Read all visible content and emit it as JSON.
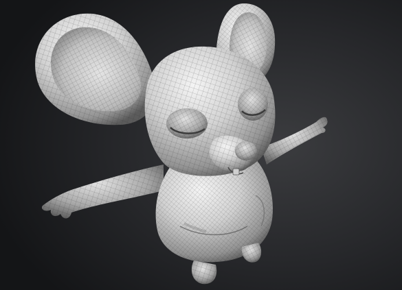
{
  "scene": {
    "subject": "mouse-character-mesh",
    "background_colors": [
      "#3a3b3e",
      "#202124",
      "#111214"
    ],
    "mesh_colors": [
      "#f1f1f1",
      "#c9c9c9",
      "#8f8f8f",
      "#4a4a4a"
    ],
    "wire_color": "#2a2a2a"
  }
}
